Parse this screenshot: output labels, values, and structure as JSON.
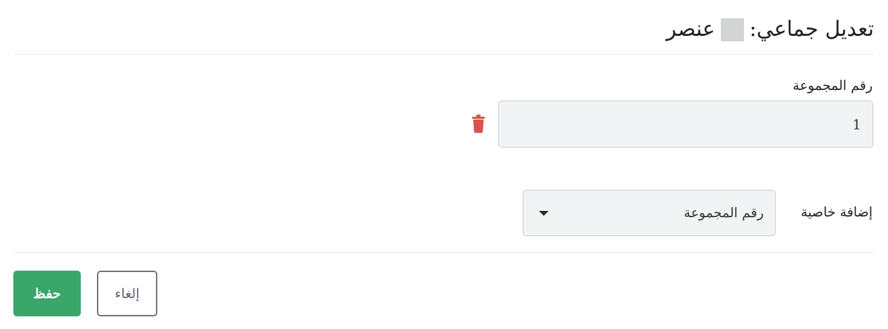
{
  "header": {
    "title": "تعديل جماعي:",
    "count_label": "عنصر"
  },
  "group_field": {
    "label": "رقم المجموعة",
    "value": "1",
    "delete_icon": "trash-icon",
    "delete_color": "#d9534f"
  },
  "add_property": {
    "label": "إضافة خاصية",
    "selected": "رقم المجموعة",
    "caret_icon": "caret-down-icon"
  },
  "footer": {
    "save_label": "حفظ",
    "cancel_label": "إلغاء",
    "save_color": "#3aa66a"
  }
}
